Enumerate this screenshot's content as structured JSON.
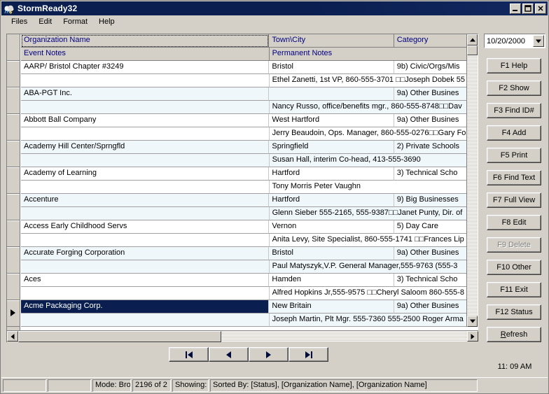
{
  "window": {
    "title": "StormReady32",
    "icon": "app-icon",
    "minimize_label": "_",
    "maximize_label": "☐",
    "close_label": "✕"
  },
  "menubar": {
    "items": [
      {
        "label": "Files"
      },
      {
        "label": "Edit"
      },
      {
        "label": "Format"
      },
      {
        "label": "Help"
      }
    ]
  },
  "grid": {
    "headers": {
      "organization_name": "Organization Name",
      "town_city": "Town\\City",
      "category": "Category",
      "event_notes": "Event Notes",
      "permanent_notes": "Permanent Notes"
    },
    "rows": [
      {
        "organization_name": "AARP/ Bristol Chapter #3249",
        "town_city": "Bristol",
        "category": "9b) Civic/Orgs/Mis",
        "event_notes": "",
        "permanent_notes": "Ethel Zanetti, 1st VP, 860-555-3701  □□Joseph Dobek 55",
        "shade": "white",
        "selected": false
      },
      {
        "organization_name": "ABA-PGT Inc.",
        "town_city": "",
        "category": "9a) Other Busines",
        "event_notes": "",
        "permanent_notes": "Nancy Russo, office/benefits mgr., 860-555-8748□□Dav",
        "shade": "blue",
        "selected": false
      },
      {
        "organization_name": "Abbott Ball Company",
        "town_city": "West Hartford",
        "category": "9a) Other Busines",
        "event_notes": "",
        "permanent_notes": "Jerry Beaudoin, Ops. Manager, 860-555-0276□□Gary Fo",
        "shade": "white",
        "selected": false
      },
      {
        "organization_name": "Academy Hill Center/Sprngfld",
        "town_city": "Springfield",
        "category": "2) Private Schools",
        "event_notes": "",
        "permanent_notes": "Susan Hall, interim Co-head, 413-555-3690",
        "shade": "blue",
        "selected": false
      },
      {
        "organization_name": "Academy of Learning",
        "town_city": "Hartford",
        "category": "3) Technical Scho",
        "event_notes": "",
        "permanent_notes": "Tony Morris Peter Vaughn",
        "shade": "white",
        "selected": false
      },
      {
        "organization_name": "Accenture",
        "town_city": "Hartford",
        "category": "9) Big Businesses",
        "event_notes": "",
        "permanent_notes": "Glenn Sieber 555-2165, 555-9387□□Janet Punty, Dir. of",
        "shade": "blue",
        "selected": false
      },
      {
        "organization_name": "Access Early Childhood Servs",
        "town_city": "Vernon",
        "category": "5) Day Care",
        "event_notes": "",
        "permanent_notes": "Anita Levy, Site Specialist, 860-555-1741  □□Frances Lip",
        "shade": "white",
        "selected": false
      },
      {
        "organization_name": "Accurate Forging Corporation",
        "town_city": "Bristol",
        "category": "9a) Other Busines",
        "event_notes": "",
        "permanent_notes": "Paul Matyszyk,V.P. General Manager,555-9763    (555-3",
        "shade": "blue",
        "selected": false
      },
      {
        "organization_name": "Aces",
        "town_city": "Hamden",
        "category": "3) Technical Scho",
        "event_notes": "",
        "permanent_notes": "Alfred Hopkins Jr,555-9575  □□Cheryl Saloom 860-555-8",
        "shade": "white",
        "selected": false
      },
      {
        "organization_name": "Acme Packaging Corp.",
        "town_city": "New Britain",
        "category": "9a) Other Busines",
        "event_notes": "",
        "permanent_notes": "Joseph Martin, Plt Mgr. 555-7360    555-2500 Roger Arma",
        "shade": "blue",
        "selected": true
      }
    ]
  },
  "sidepanel": {
    "date_value": "10/20/2000",
    "buttons": [
      {
        "label": "F1 Help",
        "name": "f1-help-button",
        "disabled": false
      },
      {
        "label": "F2 Show",
        "name": "f2-show-button",
        "disabled": false
      },
      {
        "label": "F3 Find ID#",
        "name": "f3-find-id-button",
        "disabled": false
      },
      {
        "label": "F4 Add",
        "name": "f4-add-button",
        "disabled": false
      },
      {
        "label": "F5 Print",
        "name": "f5-print-button",
        "disabled": false
      },
      {
        "label": "F6 Find Text",
        "name": "f6-find-text-button",
        "disabled": false
      },
      {
        "label": "F7 Full  View",
        "name": "f7-full-view-button",
        "disabled": false
      },
      {
        "label": "F8 Edit",
        "name": "f8-edit-button",
        "disabled": false
      },
      {
        "label": "F9 Delete",
        "name": "f9-delete-button",
        "disabled": true
      },
      {
        "label": "F10 Other",
        "name": "f10-other-button",
        "disabled": false
      },
      {
        "label": "F11 Exit",
        "name": "f11-exit-button",
        "disabled": false
      },
      {
        "label": "F12 Status",
        "name": "f12-status-button",
        "disabled": false
      },
      {
        "label": "Refresh",
        "name": "refresh-button",
        "disabled": false
      }
    ]
  },
  "navigation": {
    "first_label": "first-record",
    "previous_label": "previous-record",
    "next_label": "next-record",
    "last_label": "last-record"
  },
  "clock": {
    "time": "11: 09 AM"
  },
  "statusbar": {
    "pane1": "",
    "pane2": "",
    "mode": "Mode: Bro",
    "count": "2196 of 2",
    "showing": "Showing: .",
    "sorted_by": "Sorted By: [Status], [Organization Name], [Organization Name]"
  },
  "colors": {
    "titlebar": "#0a1e50",
    "face": "#d4d0c8",
    "header_text": "#000080",
    "selection": "#0a1e50",
    "row_alt": "#eff7fb"
  }
}
